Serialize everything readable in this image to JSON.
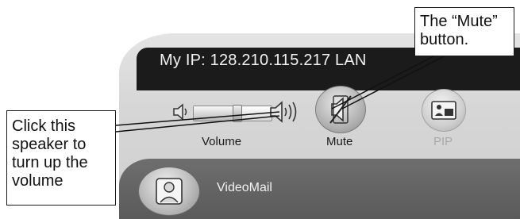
{
  "ip_bar": {
    "text": "My IP: 128.210.115.217 LAN"
  },
  "volume": {
    "label": "Volume",
    "level": 0.55,
    "low_icon": "speaker-low-icon",
    "high_icon": "speaker-high-icon"
  },
  "mute": {
    "label": "Mute",
    "icon": "mute-speaker-icon"
  },
  "pip": {
    "label": "PIP",
    "icon": "picture-in-picture-icon"
  },
  "videomail": {
    "label": "VideoMail",
    "icon": "videomail-person-icon"
  },
  "callouts": {
    "mute_lines": [
      "The “Mute”",
      "button."
    ],
    "speaker_lines": [
      "Click this",
      "speaker to",
      "turn up the",
      "volume"
    ]
  },
  "colors": {
    "ip_bar_bg": "#1b1b1b",
    "panel_bg": "#d6d6d6",
    "videomail_bg": "#666666",
    "pip_disabled": "#a9a9a9"
  }
}
